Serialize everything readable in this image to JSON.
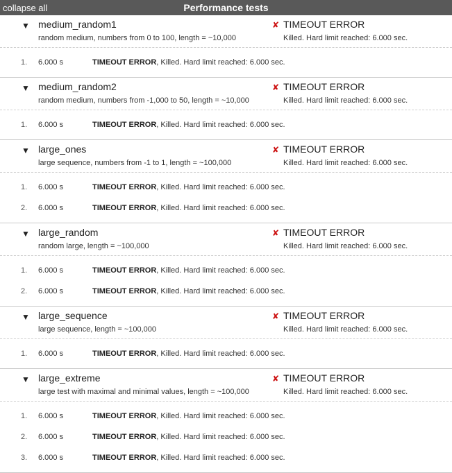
{
  "header": {
    "collapse_label": "collapse all",
    "title": "Performance tests"
  },
  "colors": {
    "header_bg": "#595959",
    "error_cross": "#cc1111"
  },
  "icons": {
    "expanded": "triangle-down-icon",
    "failed": "cross-icon"
  },
  "tests": [
    {
      "name": "medium_random1",
      "description": "random medium, numbers from 0 to 100, length = ~10,000",
      "status": "TIMEOUT ERROR",
      "status_detail": "Killed. Hard limit reached: 6.000 sec.",
      "runs": [
        {
          "num": "1.",
          "time": "6.000 s",
          "status": "TIMEOUT ERROR",
          "detail": ", Killed. Hard limit reached: 6.000 sec."
        }
      ]
    },
    {
      "name": "medium_random2",
      "description": "random medium, numbers from -1,000 to 50, length = ~10,000",
      "status": "TIMEOUT ERROR",
      "status_detail": "Killed. Hard limit reached: 6.000 sec.",
      "runs": [
        {
          "num": "1.",
          "time": "6.000 s",
          "status": "TIMEOUT ERROR",
          "detail": ", Killed. Hard limit reached: 6.000 sec."
        }
      ]
    },
    {
      "name": "large_ones",
      "description": "large sequence, numbers from -1 to 1, length = ~100,000",
      "status": "TIMEOUT ERROR",
      "status_detail": "Killed. Hard limit reached: 6.000 sec.",
      "runs": [
        {
          "num": "1.",
          "time": "6.000 s",
          "status": "TIMEOUT ERROR",
          "detail": ", Killed. Hard limit reached: 6.000 sec."
        },
        {
          "num": "2.",
          "time": "6.000 s",
          "status": "TIMEOUT ERROR",
          "detail": ", Killed. Hard limit reached: 6.000 sec."
        }
      ]
    },
    {
      "name": "large_random",
      "description": "random large, length = ~100,000",
      "status": "TIMEOUT ERROR",
      "status_detail": "Killed. Hard limit reached: 6.000 sec.",
      "runs": [
        {
          "num": "1.",
          "time": "6.000 s",
          "status": "TIMEOUT ERROR",
          "detail": ", Killed. Hard limit reached: 6.000 sec."
        },
        {
          "num": "2.",
          "time": "6.000 s",
          "status": "TIMEOUT ERROR",
          "detail": ", Killed. Hard limit reached: 6.000 sec."
        }
      ]
    },
    {
      "name": "large_sequence",
      "description": "large sequence, length = ~100,000",
      "status": "TIMEOUT ERROR",
      "status_detail": "Killed. Hard limit reached: 6.000 sec.",
      "runs": [
        {
          "num": "1.",
          "time": "6.000 s",
          "status": "TIMEOUT ERROR",
          "detail": ", Killed. Hard limit reached: 6.000 sec."
        }
      ]
    },
    {
      "name": "large_extreme",
      "description": "large test with maximal and minimal values, length = ~100,000",
      "status": "TIMEOUT ERROR",
      "status_detail": "Killed. Hard limit reached: 6.000 sec.",
      "runs": [
        {
          "num": "1.",
          "time": "6.000 s",
          "status": "TIMEOUT ERROR",
          "detail": ", Killed. Hard limit reached: 6.000 sec."
        },
        {
          "num": "2.",
          "time": "6.000 s",
          "status": "TIMEOUT ERROR",
          "detail": ", Killed. Hard limit reached: 6.000 sec."
        },
        {
          "num": "3.",
          "time": "6.000 s",
          "status": "TIMEOUT ERROR",
          "detail": ", Killed. Hard limit reached: 6.000 sec."
        }
      ]
    }
  ]
}
